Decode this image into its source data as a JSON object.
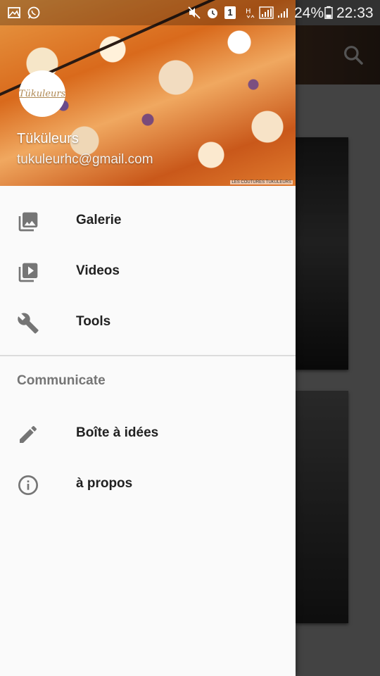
{
  "status_bar": {
    "battery_percent": "24%",
    "time": "22:33",
    "notification_count": "1"
  },
  "drawer": {
    "header": {
      "avatar_text": "Tükuleurs",
      "user_name": "Tüküleurs",
      "user_email": "tukuleurhc@gmail.com",
      "image_caption": "LES COUTURES TUKULEURS"
    },
    "items": [
      {
        "label": "Galerie",
        "icon": "photo-library-icon"
      },
      {
        "label": "Videos",
        "icon": "video-library-icon"
      },
      {
        "label": "Tools",
        "icon": "wrench-icon"
      }
    ],
    "section_title": "Communicate",
    "section_items": [
      {
        "label": "Boîte à idées",
        "icon": "pencil-icon"
      },
      {
        "label": "à propos",
        "icon": "info-icon"
      }
    ]
  },
  "colors": {
    "drawer_bg": "#fafafa",
    "text_primary": "#212121",
    "text_secondary": "#757575",
    "icon": "#757575",
    "header_accent": "#d96a1c"
  }
}
